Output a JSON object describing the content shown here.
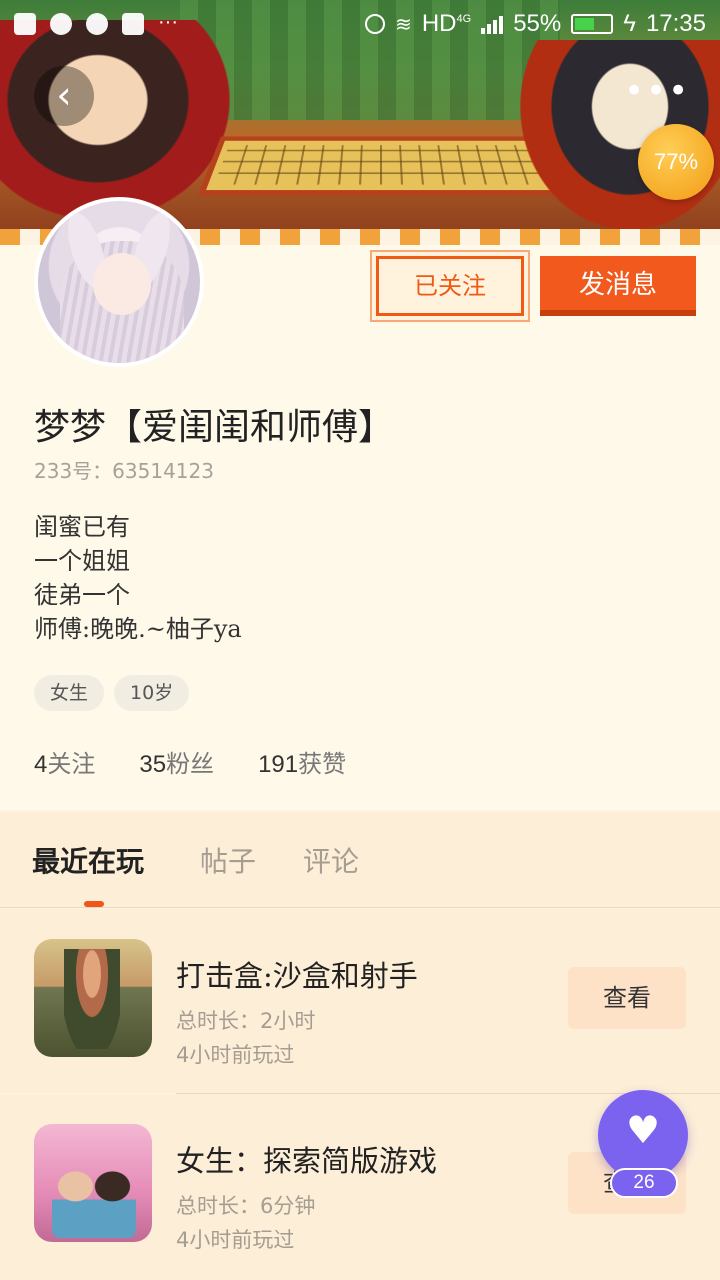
{
  "status_bar": {
    "network": "HD",
    "network_sub": "4G",
    "battery": "55%",
    "battery_level": 0.55,
    "time": "17:35",
    "icons": [
      "app-icon",
      "search-icon",
      "browser-icon",
      "grid-icon",
      "more-dots-icon",
      "sound-icon",
      "wifi-icon",
      "signal-icon",
      "battery-icon",
      "charging-icon"
    ]
  },
  "header": {
    "back_icon": "‹",
    "more_icon": "•••",
    "progress_badge": "77%"
  },
  "profile": {
    "followed_label": "已关注",
    "message_label": "发消息",
    "nickname": "梦梦【爱闺闺和师傅】",
    "id_text": "233号：63514123",
    "bio": [
      "闺蜜已有",
      "一个姐姐",
      "徒弟一个",
      "师傅:晚晚.~柚子ya"
    ],
    "tags": [
      "女生",
      "10岁"
    ],
    "stats": [
      {
        "num": "4",
        "label": "关注"
      },
      {
        "num": "35",
        "label": "粉丝"
      },
      {
        "num": "191",
        "label": "获赞"
      }
    ]
  },
  "tabs": [
    "最近在玩",
    "帖子",
    "评论"
  ],
  "games": [
    {
      "title": "打击盒:沙盒和射手",
      "duration": "总时长：2小时",
      "last_played": "4小时前玩过",
      "action": "查看"
    },
    {
      "title": "女生：探索简版游戏",
      "duration": "总时长：6分钟",
      "last_played": "4小时前玩过",
      "action": "查看"
    }
  ],
  "like": {
    "icon": "♥",
    "count": "26"
  },
  "colors": {
    "accent": "#f2591d",
    "like_purple": "#7b63f0",
    "page_bg": "#fdf3e2"
  }
}
